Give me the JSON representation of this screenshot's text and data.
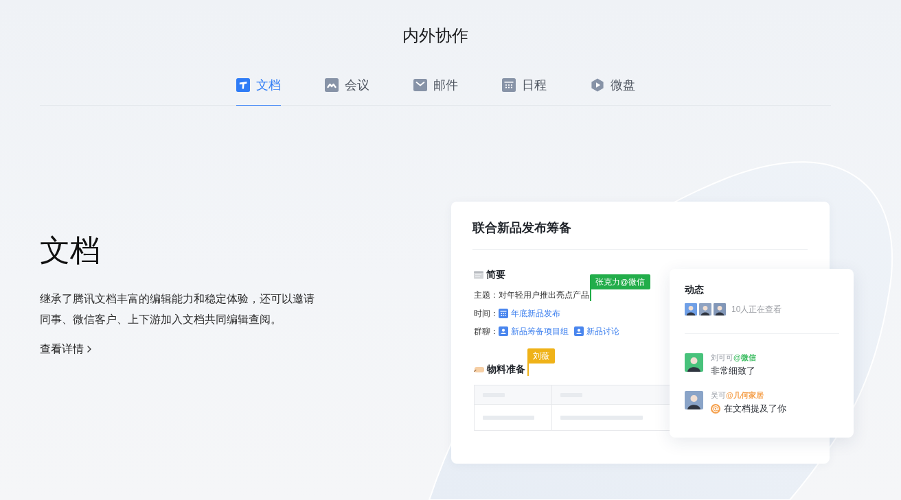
{
  "header": {
    "title": "内外协作"
  },
  "tabs": [
    {
      "label": "文档",
      "selected": true
    },
    {
      "label": "会议",
      "selected": false
    },
    {
      "label": "邮件",
      "selected": false
    },
    {
      "label": "日程",
      "selected": false
    },
    {
      "label": "微盘",
      "selected": false
    }
  ],
  "feature": {
    "title": "文档",
    "description": "继承了腾讯文档丰富的编辑能力和稳定体验，还可以邀请同事、微信客户、上下游加入文档共同编辑查阅。",
    "link": "查看详情"
  },
  "doc": {
    "title": "联合新品发布筹备",
    "sections": [
      {
        "kind": "fields",
        "heading": "简要",
        "rows": [
          {
            "kind": "text",
            "label": "主题：",
            "value": "对年轻用户推出亮点产品",
            "cursor": {
              "name": "张克力@微信",
              "color": "#22ad4a"
            }
          },
          {
            "kind": "links",
            "label": "时间：",
            "links": [
              {
                "kind": "calendar",
                "text": "年底新品发布"
              }
            ]
          },
          {
            "kind": "links",
            "label": "群聊：",
            "links": [
              {
                "kind": "group",
                "text": "新品筹备项目组"
              },
              {
                "kind": "group",
                "text": "新品讨论"
              }
            ]
          }
        ]
      },
      {
        "kind": "table",
        "heading": "物料准备",
        "cursor": {
          "name": "刘薇",
          "color": "#efb218"
        }
      }
    ]
  },
  "activity": {
    "title": "动态",
    "viewers": "10人正在查看",
    "comments": [
      {
        "kind": "comment",
        "author": "刘可可",
        "org": "@微信",
        "color": "#3dbd62",
        "text": "非常细致了"
      },
      {
        "kind": "mention",
        "author": "吴可",
        "org": "@几何家居",
        "color": "#f5a04c",
        "text": "在文档提及了你"
      }
    ]
  }
}
